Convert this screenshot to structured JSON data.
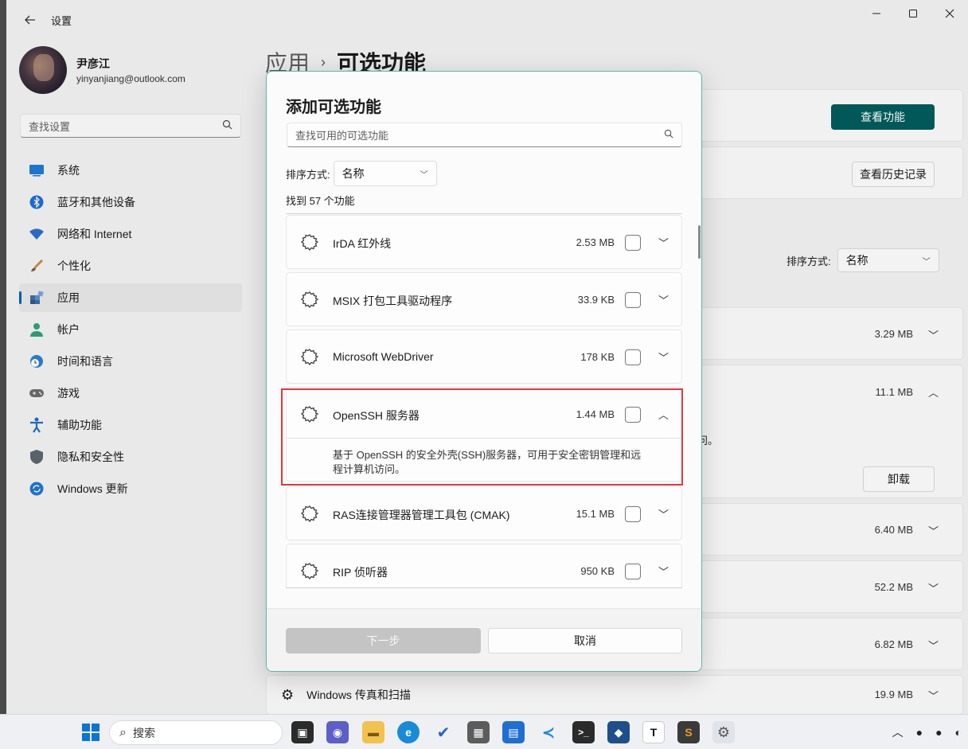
{
  "window": {
    "title": "设置"
  },
  "user": {
    "name": "尹彦江",
    "email": "yinyanjiang@outlook.com"
  },
  "sidebar": {
    "search_placeholder": "查找设置",
    "items": [
      {
        "label": "系统",
        "icon": "system-icon",
        "color": "#1f7ad6"
      },
      {
        "label": "蓝牙和其他设备",
        "icon": "bluetooth-icon",
        "color": "#1d6fd6"
      },
      {
        "label": "网络和 Internet",
        "icon": "wifi-icon",
        "color": "#2a6fd0"
      },
      {
        "label": "个性化",
        "icon": "brush-icon",
        "color": "#d08a3c"
      },
      {
        "label": "应用",
        "icon": "apps-icon",
        "color": "#3b6ea8",
        "active": true
      },
      {
        "label": "帐户",
        "icon": "account-icon",
        "color": "#2fa27a"
      },
      {
        "label": "时间和语言",
        "icon": "clock-globe-icon",
        "color": "#2a7fd0"
      },
      {
        "label": "游戏",
        "icon": "gamepad-icon",
        "color": "#6c6c6c"
      },
      {
        "label": "辅助功能",
        "icon": "accessibility-icon",
        "color": "#1c6fc8"
      },
      {
        "label": "隐私和安全性",
        "icon": "shield-icon",
        "color": "#5c6670"
      },
      {
        "label": "Windows 更新",
        "icon": "update-icon",
        "color": "#1e78d2"
      }
    ]
  },
  "main": {
    "breadcrumb_parent": "应用",
    "breadcrumb_current": "可选功能",
    "view_features_btn": "查看功能",
    "view_history_btn": "查看历史记录",
    "sort_label": "排序方式:",
    "sort_value": "名称",
    "uninstall_btn": "卸载",
    "partial_text": "问。",
    "installed_sizes": [
      "3.29 MB",
      "11.1 MB",
      "6.40 MB",
      "52.2 MB",
      "6.82 MB"
    ],
    "bottom_item": {
      "name": "Windows 传真和扫描",
      "size": "19.9 MB"
    }
  },
  "dialog": {
    "title": "添加可选功能",
    "search_placeholder": "查找可用的可选功能",
    "sort_label": "排序方式:",
    "sort_value": "名称",
    "count_text": "找到 57 个功能",
    "features": [
      {
        "name": "IrDA 红外线",
        "size": "2.53 MB",
        "checked": false
      },
      {
        "name": "MSIX 打包工具驱动程序",
        "size": "33.9 KB",
        "checked": false
      },
      {
        "name": "Microsoft WebDriver",
        "size": "178 KB",
        "checked": false
      },
      {
        "name": "OpenSSH 服务器",
        "size": "1.44 MB",
        "checked": false,
        "expanded": true,
        "description": "基于 OpenSSH 的安全外壳(SSH)服务器，可用于安全密钥管理和远程计算机访问。"
      },
      {
        "name": "RAS连接管理器管理工具包 (CMAK)",
        "size": "15.1 MB",
        "checked": false
      },
      {
        "name": "RIP 侦听器",
        "size": "950 KB",
        "checked": false
      }
    ],
    "next_btn": "下一步",
    "cancel_btn": "取消"
  },
  "taskbar": {
    "search_label": "搜索",
    "pinned": [
      "start-icon",
      "task-view-icon",
      "teams-chat-icon",
      "file-explorer-icon",
      "edge-icon",
      "todo-icon",
      "calculator-icon",
      "store-icon",
      "vscode-icon",
      "terminal-icon",
      "virtualbox-icon",
      "typora-icon",
      "sublime-icon",
      "settings-icon"
    ],
    "accent": "#0a74d8"
  },
  "colors": {
    "accent_button": "#005c5c",
    "highlight_box": "#e0383e",
    "dialog_border": "#5bb6aa"
  }
}
